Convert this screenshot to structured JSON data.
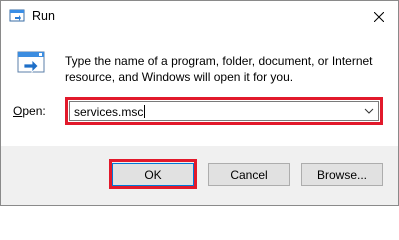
{
  "window": {
    "title": "Run",
    "close_icon": "close-icon"
  },
  "dialog": {
    "description": "Type the name of a program, folder, document, or Internet resource, and Windows will open it for you.",
    "open_label_prefix": "O",
    "open_label_rest": "pen:",
    "open_value": "services.msc"
  },
  "buttons": {
    "ok": "OK",
    "cancel": "Cancel",
    "browse": "Browse..."
  },
  "colors": {
    "highlight": "#e2192b",
    "footer": "#f0f0f0"
  }
}
